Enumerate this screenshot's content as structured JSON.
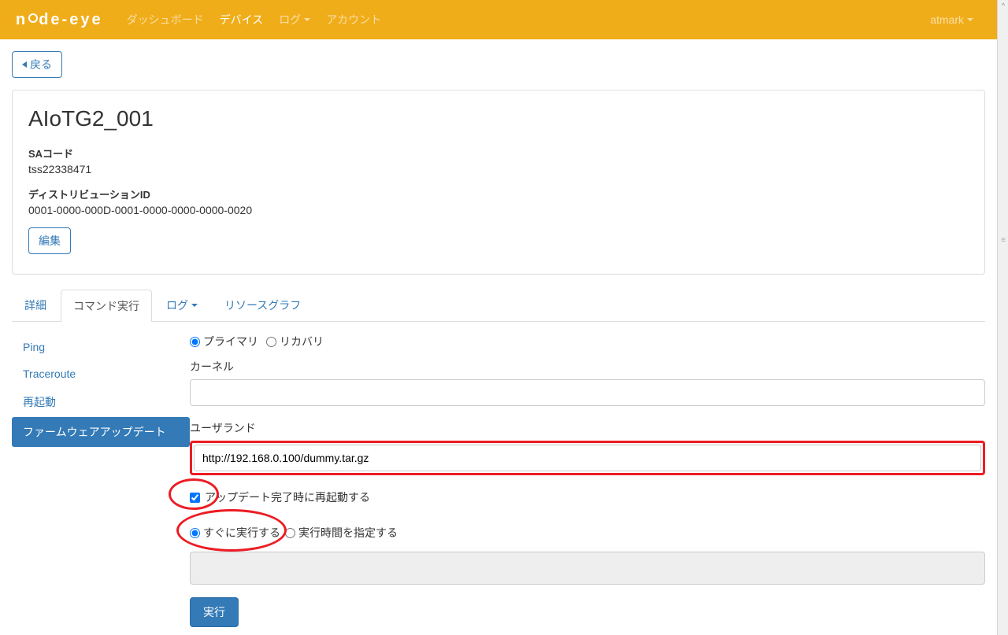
{
  "brand": "node-eye",
  "nav": {
    "dashboard": "ダッシュボード",
    "device": "デバイス",
    "log": "ログ",
    "account": "アカウント",
    "user": "atmark"
  },
  "back_label": "戻る",
  "device": {
    "name": "AIoTG2_001",
    "sa_code_label": "SAコード",
    "sa_code": "tss22338471",
    "dist_id_label": "ディストリビューションID",
    "dist_id": "0001-0000-000D-0001-0000-0000-0000-0020",
    "edit": "編集"
  },
  "tabs": {
    "detail": "詳細",
    "cmd": "コマンド実行",
    "log": "ログ",
    "resource": "リソースグラフ"
  },
  "sidebar": {
    "items": [
      {
        "label": "Ping"
      },
      {
        "label": "Traceroute"
      },
      {
        "label": "再起動"
      },
      {
        "label": "ファームウェアアップデート"
      }
    ]
  },
  "form": {
    "primary": "プライマリ",
    "recovery": "リカバリ",
    "kernel_label": "カーネル",
    "kernel_value": "",
    "userland_label": "ユーザランド",
    "userland_value": "http://192.168.0.100/dummy.tar.gz",
    "reboot_label": "アップデート完了時に再起動する",
    "exec_now": "すぐに実行する",
    "exec_time": "実行時間を指定する",
    "submit": "実行"
  }
}
